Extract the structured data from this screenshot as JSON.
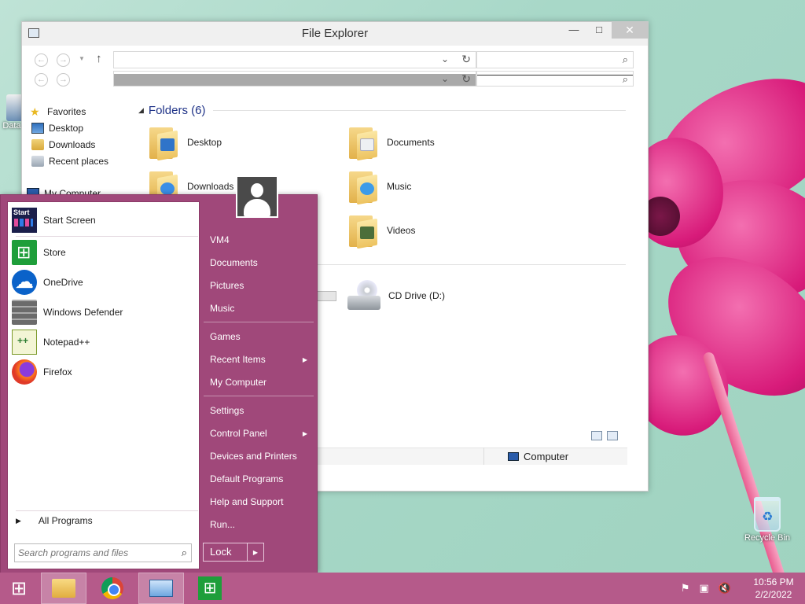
{
  "desktop": {
    "recycle_bin_label": "Recycle Bin",
    "data_icon_label": "Data"
  },
  "explorer": {
    "title": "File Explorer",
    "caption": {
      "minimize": "—",
      "maximize": "□",
      "close": "✕"
    },
    "nav_pane": {
      "items": [
        {
          "label": "Favorites",
          "icon": "star-icon"
        },
        {
          "label": "Desktop",
          "icon": "desktop-folder-icon"
        },
        {
          "label": "Downloads",
          "icon": "downloads-folder-icon"
        },
        {
          "label": "Recent places",
          "icon": "recent-places-icon"
        },
        {
          "label": "My Computer",
          "icon": "computer-icon"
        }
      ]
    },
    "folders_group": "Folders (6)",
    "folders": [
      {
        "name": "Desktop",
        "icon": "desktop-folder-icon"
      },
      {
        "name": "Documents",
        "icon": "documents-folder-icon"
      },
      {
        "name": "Downloads",
        "icon": "downloads-folder-icon"
      },
      {
        "name": "Music",
        "icon": "music-folder-icon"
      },
      {
        "name": "Videos",
        "icon": "videos-folder-icon"
      }
    ],
    "drives": [
      {
        "name": "CD Drive (D:)",
        "icon": "cd-drive-icon"
      }
    ],
    "status": {
      "location": "Computer"
    }
  },
  "start_menu": {
    "programs": [
      {
        "label": "Start Screen",
        "icon": "start-screen-icon"
      },
      {
        "label": "Store",
        "icon": "store-icon"
      },
      {
        "label": "OneDrive",
        "icon": "onedrive-icon"
      },
      {
        "label": "Windows Defender",
        "icon": "defender-icon"
      },
      {
        "label": "Notepad++",
        "icon": "notepad-plus-icon"
      },
      {
        "label": "Firefox",
        "icon": "firefox-icon"
      }
    ],
    "all_programs": "All Programs",
    "search_placeholder": "Search programs and files",
    "right_items": [
      {
        "label": "VM4",
        "arrow": false
      },
      {
        "label": "Documents",
        "arrow": false
      },
      {
        "label": "Pictures",
        "arrow": false
      },
      {
        "label": "Music",
        "arrow": false
      },
      {
        "label": "Games",
        "arrow": false
      },
      {
        "label": "Recent Items",
        "arrow": true
      },
      {
        "label": "My Computer",
        "arrow": false
      },
      {
        "label": "Settings",
        "arrow": false
      },
      {
        "label": "Control Panel",
        "arrow": true
      },
      {
        "label": "Devices and Printers",
        "arrow": false
      },
      {
        "label": "Default Programs",
        "arrow": false
      },
      {
        "label": "Help and Support",
        "arrow": false
      },
      {
        "label": "Run...",
        "arrow": false
      }
    ],
    "lock_label": "Lock",
    "accent_color": "#a0487a"
  },
  "taskbar": {
    "time": "10:56 PM",
    "date": "2/2/2022",
    "color": "#b55a8a"
  }
}
